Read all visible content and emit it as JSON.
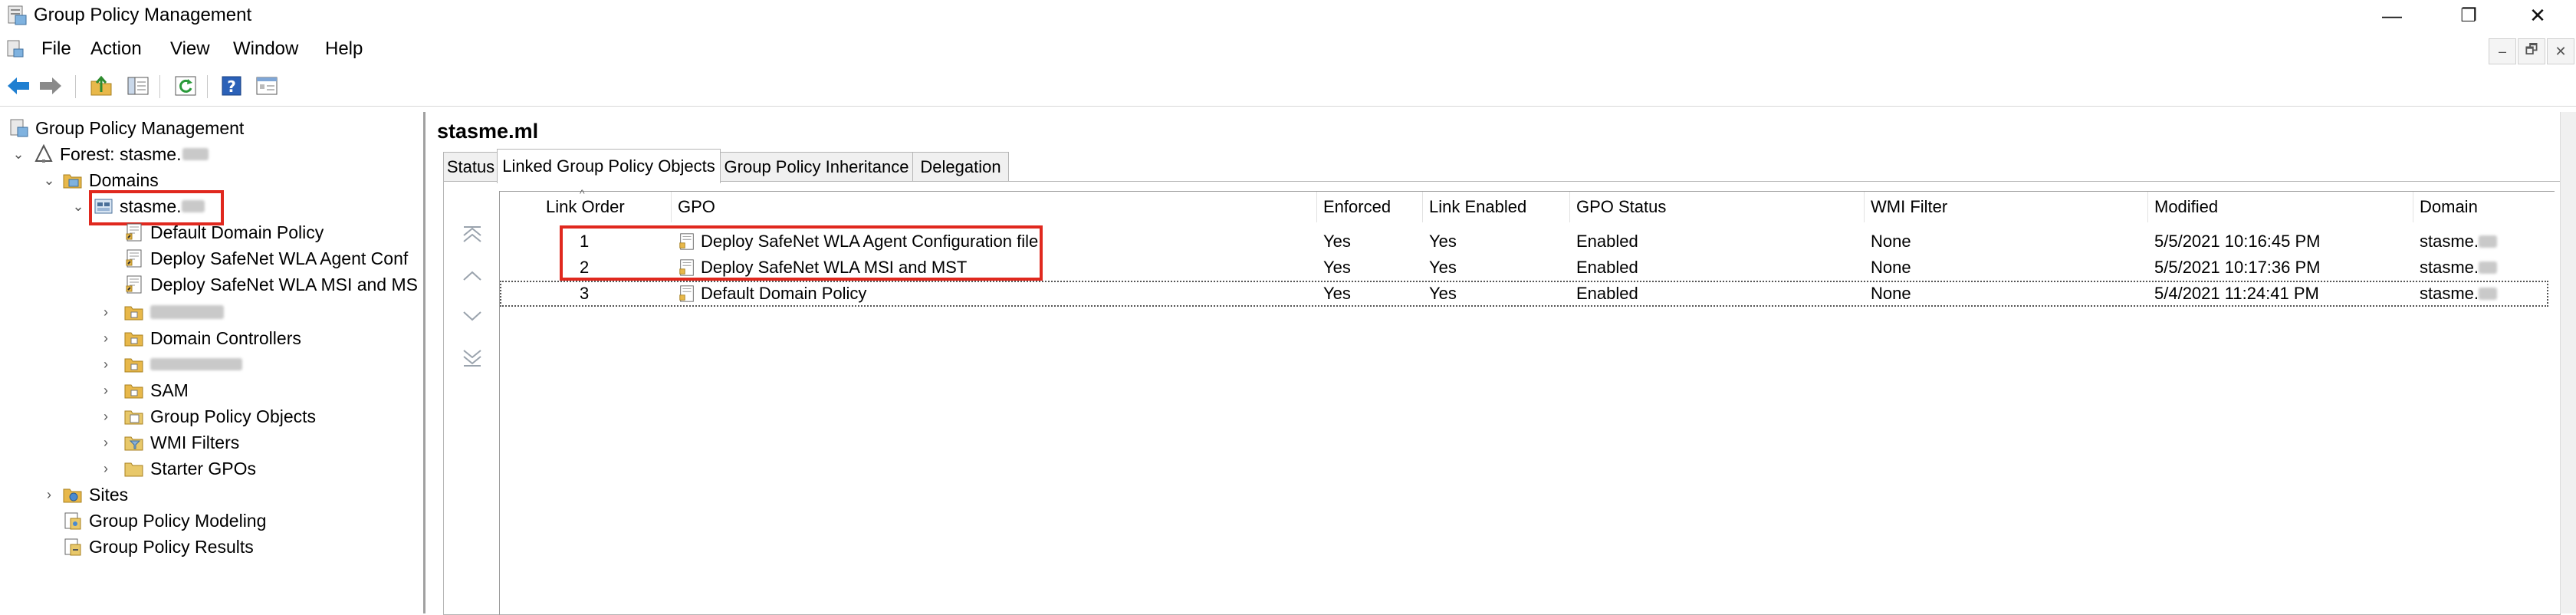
{
  "window": {
    "title": "Group Policy Management",
    "minimize_glyph": "—",
    "restore_glyph": "❐",
    "close_glyph": "✕"
  },
  "menu": [
    "File",
    "Action",
    "View",
    "Window",
    "Help"
  ],
  "mdi_buttons": [
    "–",
    "🗗",
    "✕"
  ],
  "toolbar_icons": [
    "back-arrow-icon",
    "forward-arrow-icon",
    "up-folder-icon",
    "show-hide-tree-icon",
    "refresh-icon",
    "help-icon",
    "properties-icon"
  ],
  "tree": {
    "root": "Group Policy Management",
    "forest": "Forest: stasme.",
    "domains": "Domains",
    "domain": "stasme.",
    "gpo_links": [
      "Default Domain Policy",
      "Deploy SafeNet WLA Agent Conf",
      "Deploy SafeNet WLA MSI and MS"
    ],
    "domain_controllers": "Domain Controllers",
    "sam": "SAM",
    "gpo_objects": "Group Policy Objects",
    "wmi_filters": "WMI Filters",
    "starter_gpos": "Starter GPOs",
    "sites": "Sites",
    "modeling": "Group Policy Modeling",
    "results": "Group Policy Results"
  },
  "right": {
    "heading": "stasme.ml",
    "tabs": [
      "Status",
      "Linked Group Policy Objects",
      "Group Policy Inheritance",
      "Delegation"
    ],
    "active_tab": "Linked Group Policy Objects",
    "columns": [
      "Link Order",
      "GPO",
      "Enforced",
      "Link Enabled",
      "GPO Status",
      "WMI Filter",
      "Modified",
      "Domain"
    ],
    "rows": [
      {
        "order": "1",
        "gpo": "Deploy SafeNet WLA Agent Configuration file",
        "enforced": "Yes",
        "link_enabled": "Yes",
        "status": "Enabled",
        "wmi": "None",
        "modified": "5/5/2021 10:16:45 PM",
        "domain": "stasme."
      },
      {
        "order": "2",
        "gpo": "Deploy SafeNet WLA MSI and MST",
        "enforced": "Yes",
        "link_enabled": "Yes",
        "status": "Enabled",
        "wmi": "None",
        "modified": "5/5/2021 10:17:36 PM",
        "domain": "stasme."
      },
      {
        "order": "3",
        "gpo": "Default Domain Policy",
        "enforced": "Yes",
        "link_enabled": "Yes",
        "status": "Enabled",
        "wmi": "None",
        "modified": "5/4/2021 11:24:41 PM",
        "domain": "stasme."
      }
    ]
  },
  "colors": {
    "highlight_box": "#e0281e",
    "toolbar_arrow": "#1f7fd1"
  }
}
